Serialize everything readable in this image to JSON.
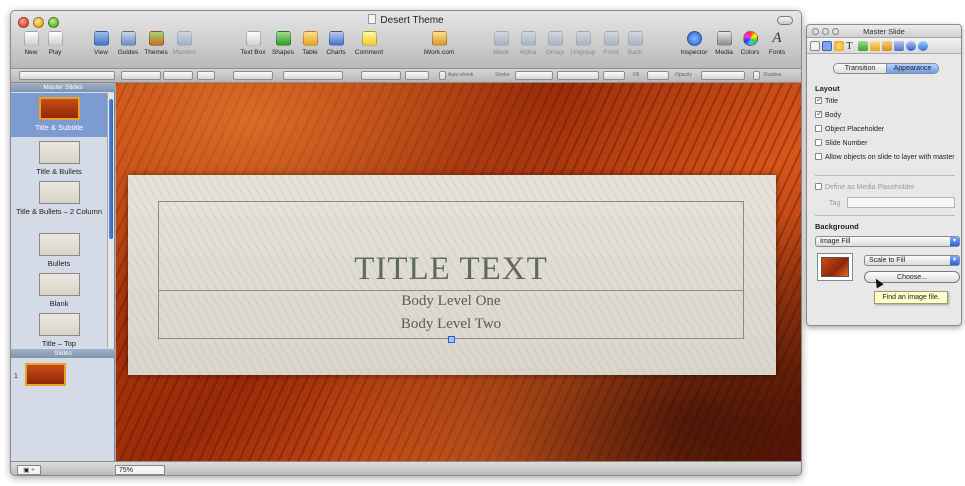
{
  "window": {
    "title": "Desert Theme"
  },
  "toolbar": {
    "items": [
      {
        "label": "New",
        "icon": "new-slide-icon"
      },
      {
        "label": "Play",
        "icon": "play-icon"
      },
      {
        "label": "View",
        "icon": "view-icon"
      },
      {
        "label": "Guides",
        "icon": "guides-icon"
      },
      {
        "label": "Themes",
        "icon": "themes-icon"
      },
      {
        "label": "Masters",
        "icon": "masters-icon"
      },
      {
        "label": "Text Box",
        "icon": "text-box-icon"
      },
      {
        "label": "Shapes",
        "icon": "shapes-icon"
      },
      {
        "label": "Table",
        "icon": "table-icon"
      },
      {
        "label": "Charts",
        "icon": "charts-icon"
      },
      {
        "label": "Comment",
        "icon": "comment-icon"
      },
      {
        "label": "iWork.com",
        "icon": "iwork-icon"
      },
      {
        "label": "Mask",
        "icon": "mask-icon"
      },
      {
        "label": "Alpha",
        "icon": "alpha-icon"
      },
      {
        "label": "Group",
        "icon": "group-icon"
      },
      {
        "label": "Ungroup",
        "icon": "ungroup-icon"
      },
      {
        "label": "Front",
        "icon": "front-icon"
      },
      {
        "label": "Back",
        "icon": "back-icon"
      },
      {
        "label": "Inspector",
        "icon": "inspector-icon"
      },
      {
        "label": "Media",
        "icon": "media-icon"
      },
      {
        "label": "Colors",
        "icon": "colors-icon"
      },
      {
        "label": "Fonts",
        "icon": "fonts-icon"
      }
    ]
  },
  "format_bar": {
    "auto_shrink": "Auto-shrink",
    "stroke": "Stroke",
    "fill": "Fill",
    "opacity": "Opacity",
    "shadow": "Shadow"
  },
  "sidebar": {
    "masters_header": "Master Slides",
    "masters": [
      {
        "label": "Title & Subtitle",
        "selected": true
      },
      {
        "label": "Title & Bullets",
        "selected": false
      },
      {
        "label": "Title & Bullets – 2 Column",
        "selected": false
      },
      {
        "label": "Bullets",
        "selected": false
      },
      {
        "label": "Blank",
        "selected": false
      },
      {
        "label": "Title – Top",
        "selected": false
      }
    ],
    "slides_header": "Slides",
    "slides": [
      {
        "number": "1"
      }
    ]
  },
  "slide": {
    "title": "TITLE TEXT",
    "body_1": "Body Level One",
    "body_2": "Body Level Two"
  },
  "status_bar": {
    "zoom": "75%",
    "view_button": "▣ ÷"
  },
  "inspector": {
    "title": "Master Slide",
    "tabs": [
      {
        "label": "Transition",
        "selected": false
      },
      {
        "label": "Appearance",
        "selected": true
      }
    ],
    "layout_header": "Layout",
    "layout_options": [
      {
        "label": "Title",
        "checked": true
      },
      {
        "label": "Body",
        "checked": true
      },
      {
        "label": "Object Placeholder",
        "checked": false
      },
      {
        "label": "Slide Number",
        "checked": false
      },
      {
        "label": "Allow objects on slide to layer with master",
        "checked": false
      }
    ],
    "media_placeholder": {
      "label": "Define as Media Placeholder",
      "checked": false
    },
    "tag_label": "Tag",
    "tag_value": "",
    "background_header": "Background",
    "background_fill": "Image Fill",
    "scale_mode": "Scale to Fill",
    "choose_button": "Choose...",
    "tooltip": "Find an image file."
  }
}
